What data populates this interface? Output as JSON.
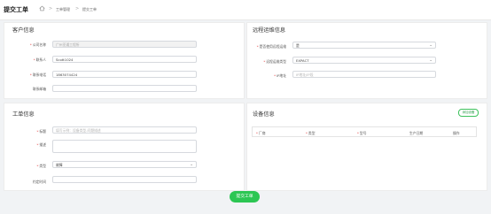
{
  "header": {
    "title": "提交工单",
    "breadcrumb": [
      "工单管理",
      "提交工单"
    ],
    "sep": ">"
  },
  "customer": {
    "section_title": "客户信息",
    "company_label": "公司名称",
    "company_value": "广州亚通工程所",
    "contact_label": "联系人",
    "contact_value": "Scott1024",
    "phone_label": "联系电话",
    "phone_value": "1863074424",
    "email_label": "联系邮箱",
    "email_value": ""
  },
  "remote": {
    "section_title": "远程运维信息",
    "use_label": "是否使用远程运维",
    "use_value": "是",
    "type_label": "远程运维类型",
    "type_value": "EXPACT",
    "ip_label": "IP地址",
    "ip_placeholder": "IP地址/IP段"
  },
  "ticket": {
    "section_title": "工单信息",
    "title_label": "标题",
    "title_placeholder": "填写示例：设备类型-问题描述",
    "desc_label": "描述",
    "type_label": "类型",
    "type_value": "故障",
    "time_label": "约定时间"
  },
  "device": {
    "section_title": "设备信息",
    "add_label": "添加设备",
    "columns": [
      "厂商",
      "类型",
      "型号",
      "生产日期",
      "操作"
    ]
  },
  "submit_label": "提交工单"
}
